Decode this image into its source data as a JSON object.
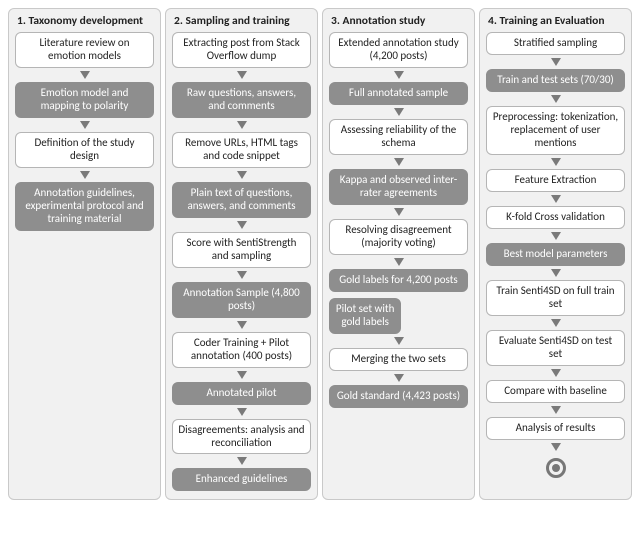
{
  "columns": [
    {
      "title": "1. Taxonomy development",
      "steps": [
        {
          "kind": "white",
          "text": "Literature review on emotion models"
        },
        {
          "kind": "arrow"
        },
        {
          "kind": "grey",
          "text": "Emotion model and mapping to polarity"
        },
        {
          "kind": "arrow"
        },
        {
          "kind": "white",
          "text": "Definition of the study design"
        },
        {
          "kind": "arrow"
        },
        {
          "kind": "grey",
          "text": "Annotation guidelines, experimental protocol and training material"
        }
      ]
    },
    {
      "title": "2. Sampling and training",
      "steps": [
        {
          "kind": "white",
          "text": "Extracting post from Stack Overflow dump"
        },
        {
          "kind": "arrow"
        },
        {
          "kind": "grey",
          "text": "Raw questions, answers, and comments"
        },
        {
          "kind": "arrow"
        },
        {
          "kind": "white",
          "text": "Remove URLs, HTML tags and code snippet"
        },
        {
          "kind": "arrow"
        },
        {
          "kind": "grey",
          "text": "Plain text of questions, answers, and comments"
        },
        {
          "kind": "arrow"
        },
        {
          "kind": "white",
          "text": "Score with SentiStrength and sampling"
        },
        {
          "kind": "arrow"
        },
        {
          "kind": "grey",
          "text": "Annotation Sample (4,800 posts)"
        },
        {
          "kind": "arrow"
        },
        {
          "kind": "white",
          "text": "Coder Training + Pilot annotation (400 posts)"
        },
        {
          "kind": "arrow"
        },
        {
          "kind": "grey",
          "text": "Annotated pilot"
        },
        {
          "kind": "arrow"
        },
        {
          "kind": "white",
          "text": "Disagreements: analysis and reconciliation"
        },
        {
          "kind": "arrow"
        },
        {
          "kind": "grey",
          "text": "Enhanced guidelines"
        }
      ]
    },
    {
      "title": "3. Annotation study",
      "steps": [
        {
          "kind": "white",
          "text": "Extended annotation study (4,200 posts)"
        },
        {
          "kind": "arrow"
        },
        {
          "kind": "grey",
          "text": "Full annotated sample"
        },
        {
          "kind": "arrow"
        },
        {
          "kind": "white",
          "text": "Assessing reliability of the schema"
        },
        {
          "kind": "arrow"
        },
        {
          "kind": "grey",
          "text": "Kappa and observed inter-rater agreements"
        },
        {
          "kind": "arrow"
        },
        {
          "kind": "white",
          "text": "Resolving disagreement (majority voting)"
        },
        {
          "kind": "arrow"
        },
        {
          "kind": "grey",
          "text": "Gold labels for 4,200 posts"
        },
        {
          "kind": "spacer"
        },
        {
          "kind": "pilot-sub",
          "text": "Pilot set with gold labels"
        },
        {
          "kind": "arrow"
        },
        {
          "kind": "white",
          "text": "Merging the two sets"
        },
        {
          "kind": "arrow"
        },
        {
          "kind": "grey",
          "text": "Gold standard (4,423 posts)"
        }
      ]
    },
    {
      "title": "4. Training an Evaluation",
      "steps": [
        {
          "kind": "white",
          "text": "Stratified sampling"
        },
        {
          "kind": "arrow"
        },
        {
          "kind": "grey",
          "text": "Train and test sets (70/30)"
        },
        {
          "kind": "arrow"
        },
        {
          "kind": "white",
          "text": "Preprocessing: tokenization, replacement of user mentions"
        },
        {
          "kind": "arrow"
        },
        {
          "kind": "white",
          "text": "Feature Extraction"
        },
        {
          "kind": "arrow"
        },
        {
          "kind": "white",
          "text": "K-fold Cross validation"
        },
        {
          "kind": "arrow"
        },
        {
          "kind": "grey",
          "text": "Best model parameters"
        },
        {
          "kind": "arrow"
        },
        {
          "kind": "white",
          "text": "Train Senti4SD on full train set"
        },
        {
          "kind": "arrow"
        },
        {
          "kind": "white",
          "text": "Evaluate Senti4SD on test set"
        },
        {
          "kind": "arrow"
        },
        {
          "kind": "white",
          "text": "Compare with baseline"
        },
        {
          "kind": "arrow"
        },
        {
          "kind": "white",
          "text": "Analysis of results"
        },
        {
          "kind": "arrow"
        },
        {
          "kind": "terminator"
        }
      ]
    }
  ]
}
